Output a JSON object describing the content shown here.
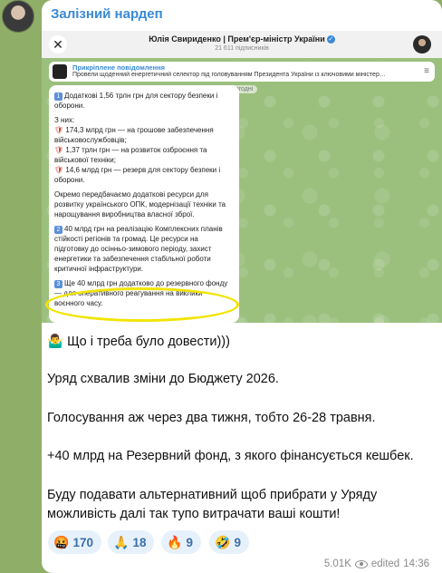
{
  "channel": {
    "sender_name": "Залізний нардеп"
  },
  "screenshot": {
    "header_title": "Юлія Свириденко | Прем'єр-міністр України",
    "header_subtitle": "21 611 підписників",
    "pinned_title": "Прикріплене повідомлення",
    "pinned_text": "Провели щоденний енергетичний селектор під головуванням Президента України із ключовими міністер…",
    "today_label": "Сьогодні",
    "paragraphs": [
      [
        "1",
        "Додаткові 1,56 трлн грн для сектору безпеки і оборони."
      ],
      [
        "",
        "З них:"
      ],
      [
        "",
        "174,3 млрд грн — на грошове забезпечення військовослужбовців;"
      ],
      [
        "",
        "1,37 трлн грн — на розвиток озброєння та військової техніки;"
      ],
      [
        "",
        "14,6 млрд грн — резерв для сектору безпеки і оборони."
      ],
      [
        "",
        "Окремо передбачаємо додаткові ресурси для розвитку українського ОПК, модернізації техніки та нарощування виробництва власної зброї."
      ],
      [
        "2",
        "40 млрд грн на реалізацію Комплексних планів стійкості регіонів та громад. Це ресурси на підготовку до осінньо-зимового періоду, захист енергетики та забезпечення стабільної роботи критичної інфраструктури."
      ],
      [
        "3",
        "Ще 40 млрд грн додатково до резервного фонду — для оперативного реагування на виклики воєнного часу."
      ]
    ]
  },
  "body": {
    "line1": "🤷‍♂️ Що і треба було довести)))",
    "line2": "Уряд схвалив зміни до Бюджету 2026.",
    "line3": "Голосування аж через два тижня, тобто 26-28 травня.",
    "line4": "+40 млрд на Резервний фонд, з якого фінансується кешбек.",
    "line5": "Буду подавати альтернативний щоб прибрати у Уряду",
    "line6": "можливість далі так тупо витрачати ваші кошти!"
  },
  "reactions": [
    {
      "emoji": "🤬",
      "count": "170"
    },
    {
      "emoji": "🙏",
      "count": "18"
    },
    {
      "emoji": "🔥",
      "count": "9"
    },
    {
      "emoji": "🤣",
      "count": "9"
    }
  ],
  "footer": {
    "views": "5.01K",
    "status": "edited",
    "time": "14:36"
  }
}
